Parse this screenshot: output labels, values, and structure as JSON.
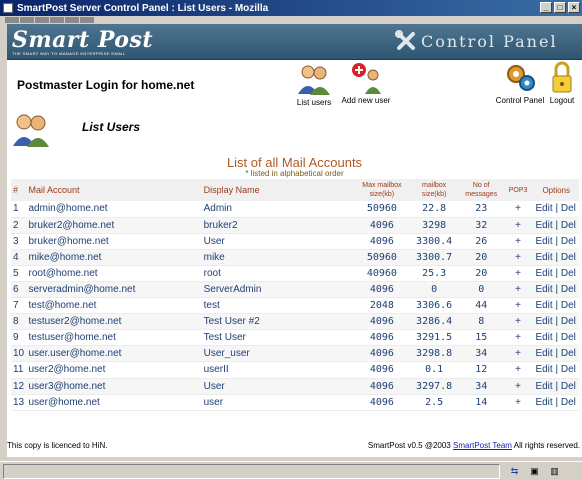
{
  "window": {
    "title": "SmartPost Server Control Panel : List Users - Mozilla"
  },
  "banner": {
    "logo": "Smart Post",
    "tagline": "THE SMART WAY TO MANAGE ENTERPRISE EMAIL",
    "control_panel": "Control Panel"
  },
  "header": {
    "heading": "Postmaster Login for home.net",
    "actions": {
      "list_users": "List users",
      "add_new_user": "Add new user",
      "control_panel": "Control Panel",
      "logout": "Logout"
    }
  },
  "section": {
    "title": "List Users"
  },
  "list": {
    "title": "List of all Mail Accounts",
    "note_star": "*",
    "note": "listed in alphabetical order",
    "columns": {
      "index": "#",
      "account": "Mail Account",
      "display": "Display Name",
      "max1": "Max mailbox",
      "max2": "size(kb)",
      "size1": "mailbox",
      "size2": "size(kb)",
      "msgs1": "No of",
      "msgs2": "messages",
      "pop3": "POP3",
      "options": "Options"
    },
    "rows": [
      {
        "n": "1",
        "account": "admin@home.net",
        "display": "Admin",
        "max": "50960",
        "size": "22.8",
        "msgs": "23",
        "pop3": "+",
        "edit": "Edit",
        "del": "Del"
      },
      {
        "n": "2",
        "account": "bruker2@home.net",
        "display": "bruker2",
        "max": "4096",
        "size": "3298",
        "msgs": "32",
        "pop3": "+",
        "edit": "Edit",
        "del": "Del"
      },
      {
        "n": "3",
        "account": "bruker@home.net",
        "display": "User",
        "max": "4096",
        "size": "3300.4",
        "msgs": "26",
        "pop3": "+",
        "edit": "Edit",
        "del": "Del"
      },
      {
        "n": "4",
        "account": "mike@home.net",
        "display": "mike",
        "max": "50960",
        "size": "3300.7",
        "msgs": "20",
        "pop3": "+",
        "edit": "Edit",
        "del": "Del"
      },
      {
        "n": "5",
        "account": "root@home.net",
        "display": "root",
        "max": "40960",
        "size": "25.3",
        "msgs": "20",
        "pop3": "+",
        "edit": "Edit",
        "del": "Del"
      },
      {
        "n": "6",
        "account": "serveradmin@home.net",
        "display": "ServerAdmin",
        "max": "4096",
        "size": "0",
        "msgs": "0",
        "pop3": "+",
        "edit": "Edit",
        "del": "Del"
      },
      {
        "n": "7",
        "account": "test@home.net",
        "display": "test",
        "max": "2048",
        "size": "3306.6",
        "msgs": "44",
        "pop3": "+",
        "edit": "Edit",
        "del": "Del"
      },
      {
        "n": "8",
        "account": "testuser2@home.net",
        "display": "Test User #2",
        "max": "4096",
        "size": "3286.4",
        "msgs": "8",
        "pop3": "+",
        "edit": "Edit",
        "del": "Del"
      },
      {
        "n": "9",
        "account": "testuser@home.net",
        "display": "Test User",
        "max": "4096",
        "size": "3291.5",
        "msgs": "15",
        "pop3": "+",
        "edit": "Edit",
        "del": "Del"
      },
      {
        "n": "10",
        "account": "user.user@home.net",
        "display": "User_user",
        "max": "4096",
        "size": "3298.8",
        "msgs": "34",
        "pop3": "+",
        "edit": "Edit",
        "del": "Del"
      },
      {
        "n": "11",
        "account": "user2@home.net",
        "display": "userII",
        "max": "4096",
        "size": "0.1",
        "msgs": "12",
        "pop3": "+",
        "edit": "Edit",
        "del": "Del"
      },
      {
        "n": "12",
        "account": "user3@home.net",
        "display": "User",
        "max": "4096",
        "size": "3297.8",
        "msgs": "34",
        "pop3": "+",
        "edit": "Edit",
        "del": "Del"
      },
      {
        "n": "13",
        "account": "user@home.net",
        "display": "user",
        "max": "4096",
        "size": "2.5",
        "msgs": "14",
        "pop3": "+",
        "edit": "Edit",
        "del": "Del"
      }
    ]
  },
  "footer": {
    "licence": "This copy is licenced to HiN.",
    "copyright_prefix": "SmartPost v0.5 @2003",
    "team_link": "SmartPost Team",
    "copyright_suffix": "All rights reserved."
  },
  "icons": {
    "app": "mozilla-icon",
    "minimize": "minimize-icon",
    "maximize": "maximize-icon",
    "close": "close-icon",
    "users": "users-icon",
    "add_user": "add-user-icon",
    "control_panel": "control-panel-icon",
    "logout": "padlock-icon",
    "control_panel_banner": "wrench-icon",
    "status_network": "network-icon",
    "status_security": "lock-icon",
    "status_offline": "offline-icon"
  },
  "colors": {
    "banner": "#3b627c",
    "heading_accent": "#9b3a1c",
    "link": "#1e3f72",
    "titlebar": "#0a246a"
  }
}
